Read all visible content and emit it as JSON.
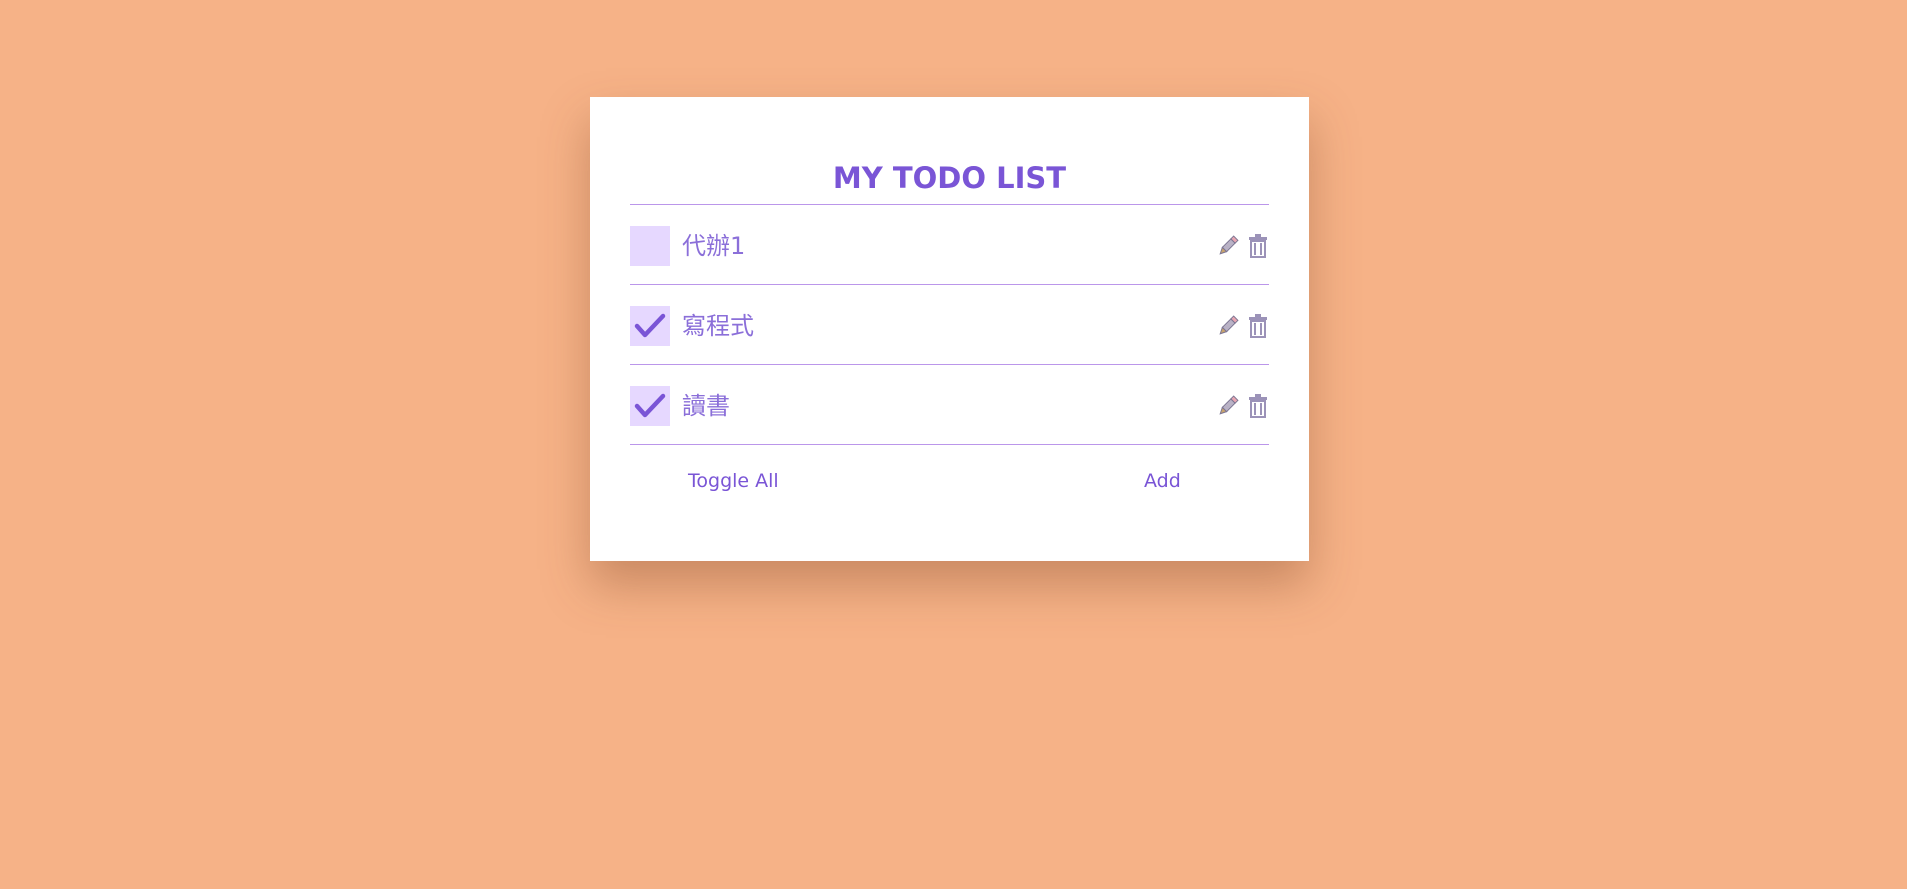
{
  "app": {
    "title": "MY TODO LIST"
  },
  "todos": [
    {
      "text": "代辦1",
      "done": false
    },
    {
      "text": "寫程式",
      "done": true
    },
    {
      "text": "讀書",
      "done": true
    }
  ],
  "icons": {
    "edit": "pencil-icon",
    "delete": "trash-icon",
    "check": "checkmark-icon"
  },
  "footer": {
    "toggle_all_label": "Toggle All",
    "add_label": "Add"
  },
  "colors": {
    "background": "#f6b287",
    "accent": "#7a55d6",
    "checkbox": "#e6d8ff",
    "divider": "#bb96ea",
    "icon_gray": "#9b92b8",
    "pencil_pink": "#e9a6b2"
  }
}
